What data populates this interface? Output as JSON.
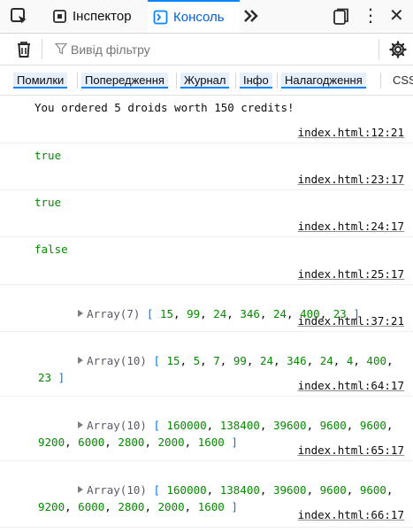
{
  "toolbar": {
    "inspector_label": "Інспектор",
    "console_label": "Консоль",
    "more_label": "»",
    "menu_label": "⋮",
    "close_label": "✕"
  },
  "filter": {
    "placeholder": "Вивід фільтру"
  },
  "levels": [
    "Помилки",
    "Попередження",
    "Журнал",
    "Інфо",
    "Налагодження"
  ],
  "css_label": "CSS",
  "messages": [
    {
      "text": "You ordered 5 droids worth 150 credits!",
      "location": "index.html:12:21"
    },
    {
      "text": "true",
      "location": "index.html:23:17"
    },
    {
      "text": "true",
      "location": "index.html:24:17"
    },
    {
      "text": "false",
      "location": "index.html:25:17"
    },
    {
      "array_label": "Array",
      "count": "(7)",
      "values": [
        "15",
        "99",
        "24",
        "346",
        "24",
        "400",
        "23"
      ],
      "location": "index.html:37:21"
    },
    {
      "array_label": "Array",
      "count": "(10)",
      "values": [
        "15",
        "5",
        "7",
        "99",
        "24",
        "346",
        "24",
        "4",
        "400",
        "23"
      ],
      "location": "index.html:64:17"
    },
    {
      "array_label": "Array",
      "count": "(10)",
      "values": [
        "160000",
        "138400",
        "39600",
        "9600",
        "9600",
        "9200",
        "6000",
        "2800",
        "2000",
        "1600"
      ],
      "location": "index.html:65:17"
    },
    {
      "array_label": "Array",
      "count": "(10)",
      "values": [
        "160000",
        "138400",
        "39600",
        "9600",
        "9600",
        "9200",
        "6000",
        "2800",
        "2000",
        "1600"
      ],
      "location": "index.html:66:17"
    }
  ],
  "colors": {
    "accent": "#0a84ff",
    "log_green": "#058b00",
    "array_number": "#058b00"
  }
}
